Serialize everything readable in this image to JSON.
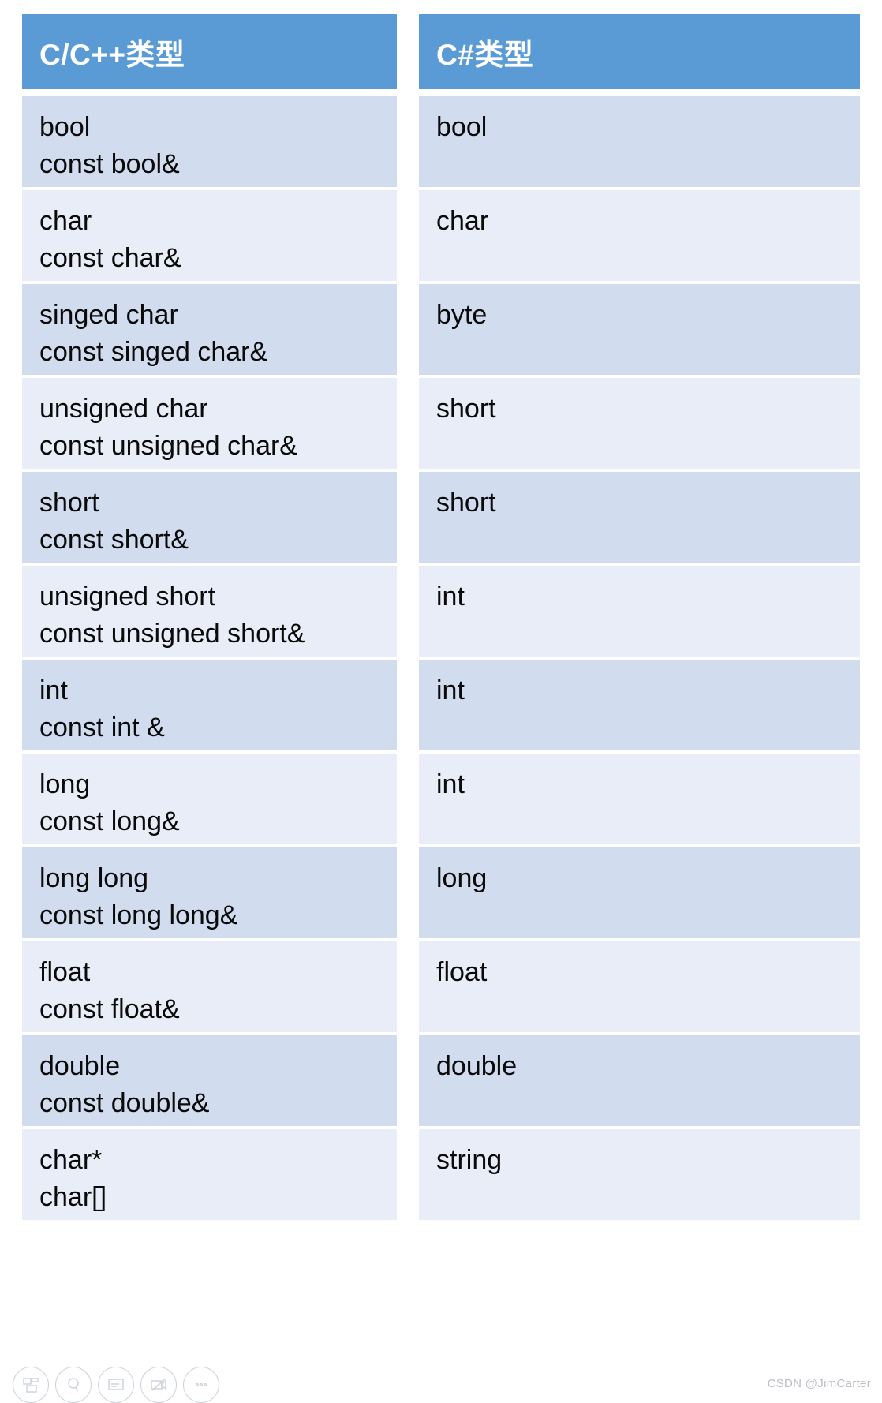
{
  "table": {
    "headers": {
      "left": "C/C++类型",
      "right": "C#类型"
    },
    "header_bg": "#5B9BD5",
    "row_bg_dark": "#D2DCEF",
    "row_bg_light": "#E9EDF7",
    "rows": [
      {
        "left_line1": "bool",
        "left_line2": "const bool&",
        "right": "bool"
      },
      {
        "left_line1": "char",
        "left_line2": "const char&",
        "right": "char"
      },
      {
        "left_line1": "singed char",
        "left_line2": "const singed char&",
        "right": "byte"
      },
      {
        "left_line1": "unsigned char",
        "left_line2": "const unsigned char&",
        "right": "short"
      },
      {
        "left_line1": "short",
        "left_line2": "const short&",
        "right": "short"
      },
      {
        "left_line1": "unsigned short",
        "left_line2": "const unsigned short&",
        "right": "int"
      },
      {
        "left_line1": "int",
        "left_line2": "const int &",
        "right": "int"
      },
      {
        "left_line1": "long",
        "left_line2": "const long&",
        "right": "int"
      },
      {
        "left_line1": "long long",
        "left_line2": "const long long&",
        "right": "long"
      },
      {
        "left_line1": "float",
        "left_line2": "const float&",
        "right": "float"
      },
      {
        "left_line1": "double",
        "left_line2": "const double&",
        "right": "double"
      },
      {
        "left_line1": "char*",
        "left_line2": "char[]",
        "right": "string"
      }
    ]
  },
  "toolbar": {
    "buttons": [
      {
        "icon": "layout-slides-icon"
      },
      {
        "icon": "circle-pen-icon"
      },
      {
        "icon": "presentation-screen-icon"
      },
      {
        "icon": "video-camera-off-icon"
      },
      {
        "icon": "more-options-icon"
      }
    ]
  },
  "watermark": {
    "text": "CSDN @JimCarter"
  }
}
